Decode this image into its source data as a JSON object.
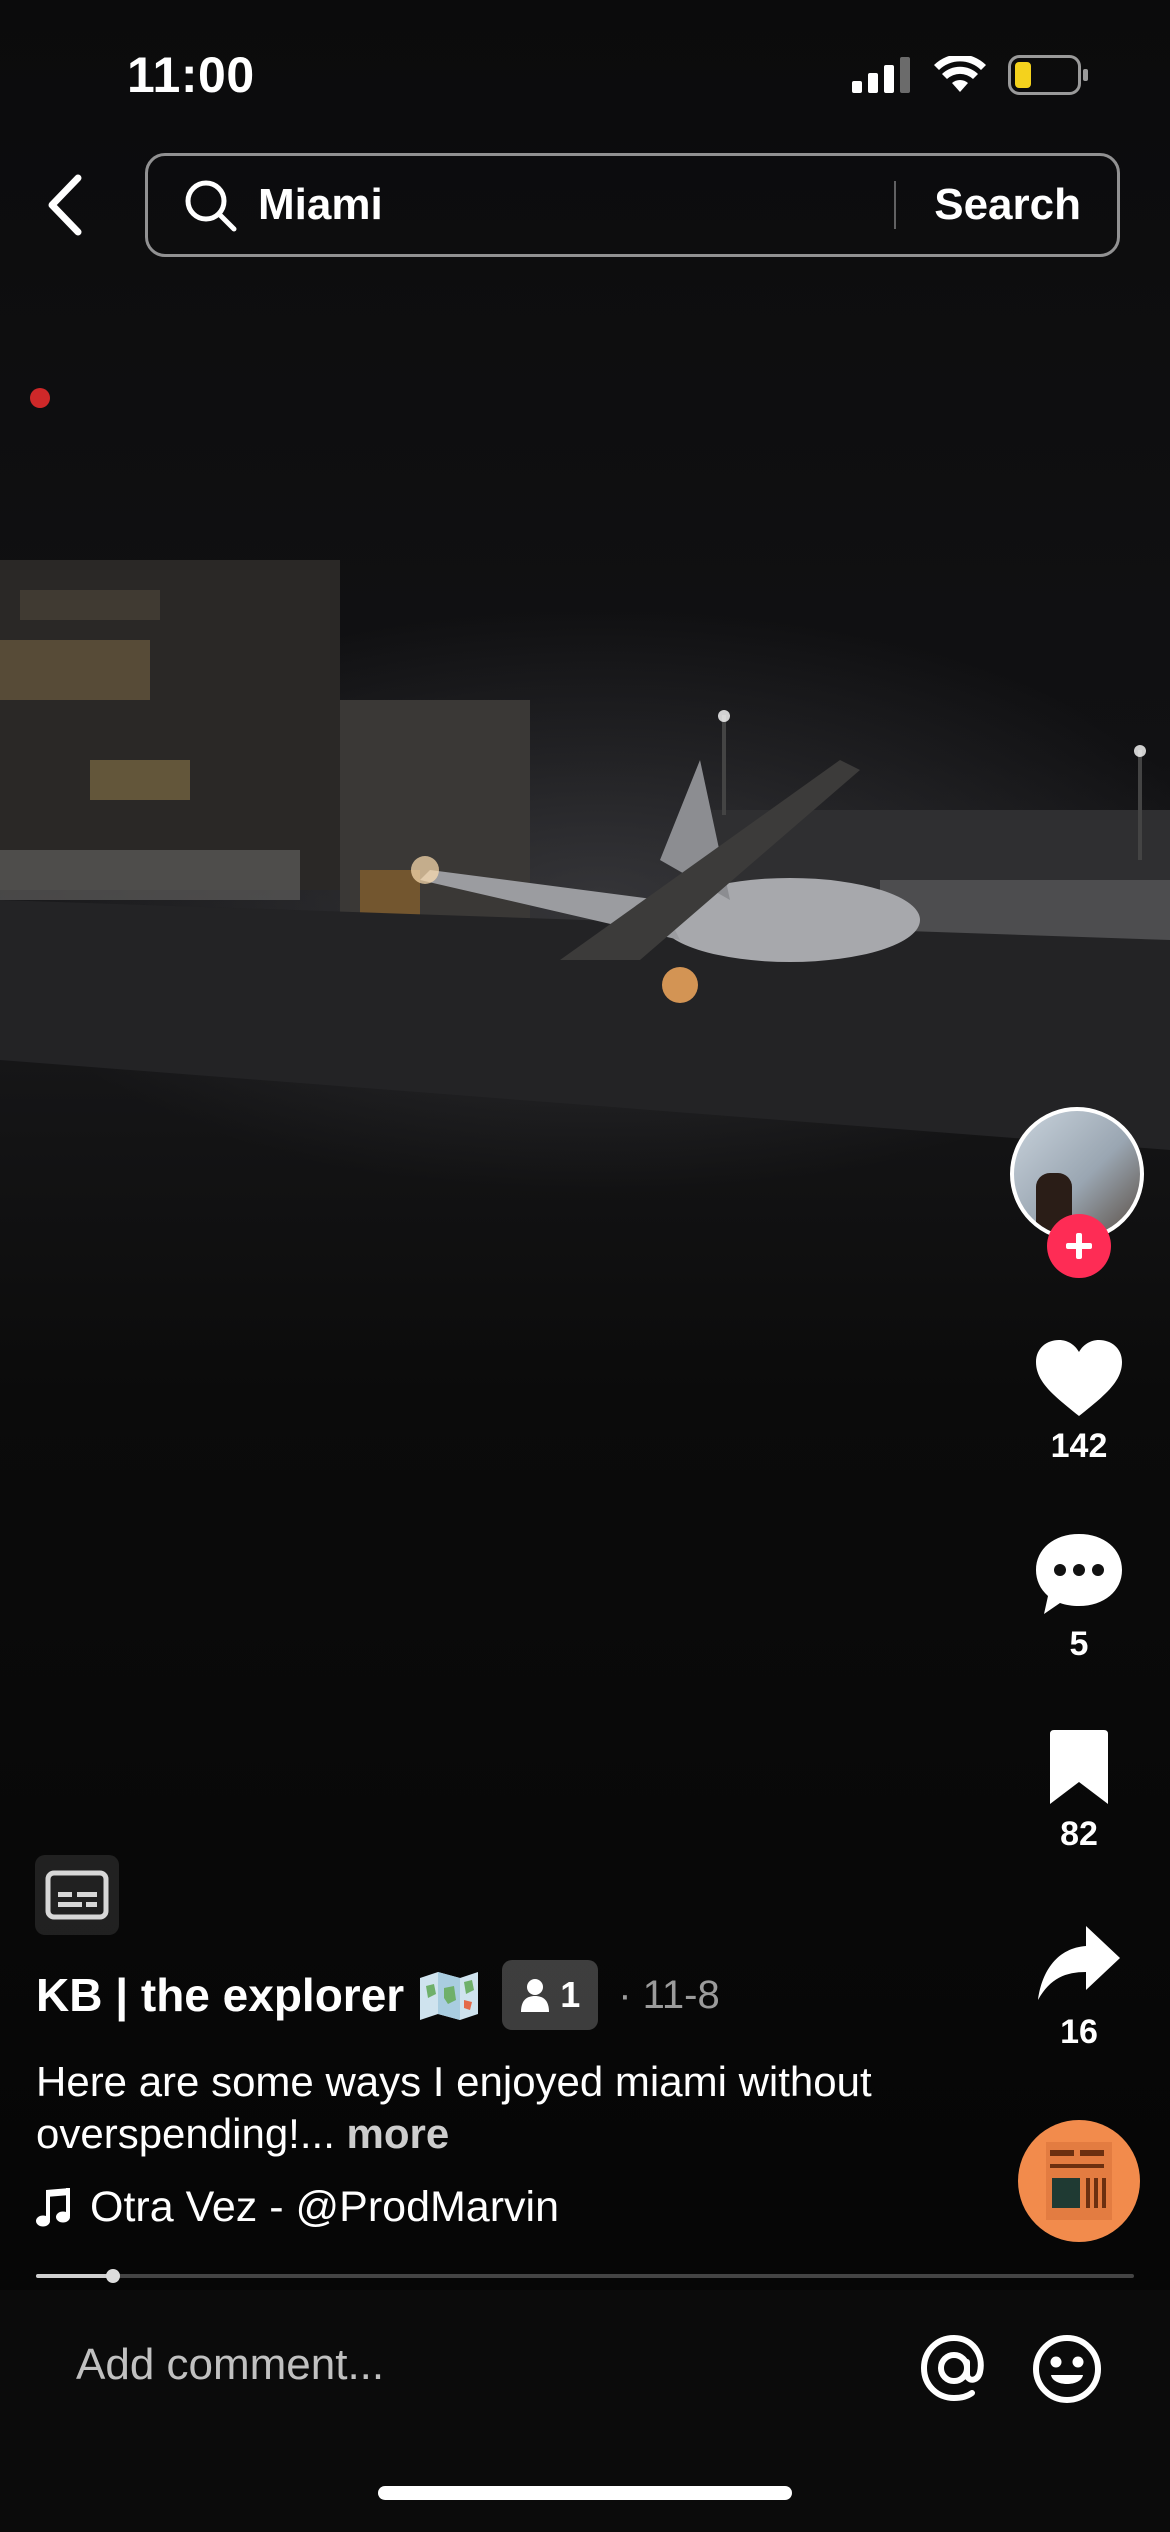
{
  "status_bar": {
    "time": "11:00",
    "battery_color": "#f4d21d"
  },
  "search": {
    "query": "Miami",
    "button_label": "Search"
  },
  "actions": {
    "likes": "142",
    "comments": "5",
    "saves": "82",
    "shares": "16"
  },
  "post": {
    "author": "KB | the explorer",
    "collaborators": "1",
    "date": "· 11-8",
    "caption": "Here are some ways I enjoyed miami without overspending!...",
    "more_label": "more",
    "music": "Otra Vez - @ProdMarvin",
    "progress": 0.07
  },
  "comment": {
    "placeholder": "Add comment..."
  },
  "colors": {
    "follow_accent": "#fe2c55",
    "disc": "#f28b4c"
  },
  "icons": [
    "back-chevron-icon",
    "search-icon",
    "heart-icon",
    "comment-bubble-icon",
    "bookmark-icon",
    "share-arrow-icon",
    "captions-icon",
    "map-emoji-icon",
    "person-icon",
    "music-note-icon",
    "at-icon",
    "emoji-icon"
  ]
}
